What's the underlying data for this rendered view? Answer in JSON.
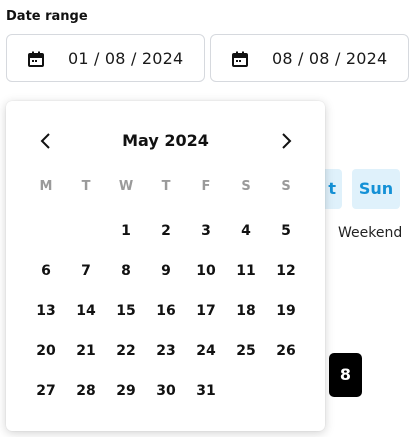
{
  "date_range": {
    "label": "Date range",
    "start": {
      "value": "01 / 08 / 2024",
      "icon": "calendar-icon"
    },
    "end": {
      "value": "08 / 08 / 2024",
      "icon": "calendar-icon"
    }
  },
  "background": {
    "chip_partial": "t",
    "chip_sun": "Sun",
    "weekend_text": "Weekend",
    "box_value": "8",
    "colors": {
      "chip_bg": "#dff1fb",
      "chip_text": "#1491d6"
    }
  },
  "calendar": {
    "month_label": "May 2024",
    "prev_icon": "chevron-left-icon",
    "next_icon": "chevron-right-icon",
    "weekdays": [
      "M",
      "T",
      "W",
      "T",
      "F",
      "S",
      "S"
    ],
    "weeks": [
      [
        "",
        "",
        "1",
        "2",
        "3",
        "4",
        "5"
      ],
      [
        "6",
        "7",
        "8",
        "9",
        "10",
        "11",
        "12"
      ],
      [
        "13",
        "14",
        "15",
        "16",
        "17",
        "18",
        "19"
      ],
      [
        "20",
        "21",
        "22",
        "23",
        "24",
        "25",
        "26"
      ],
      [
        "27",
        "28",
        "29",
        "30",
        "31",
        "",
        ""
      ]
    ]
  }
}
